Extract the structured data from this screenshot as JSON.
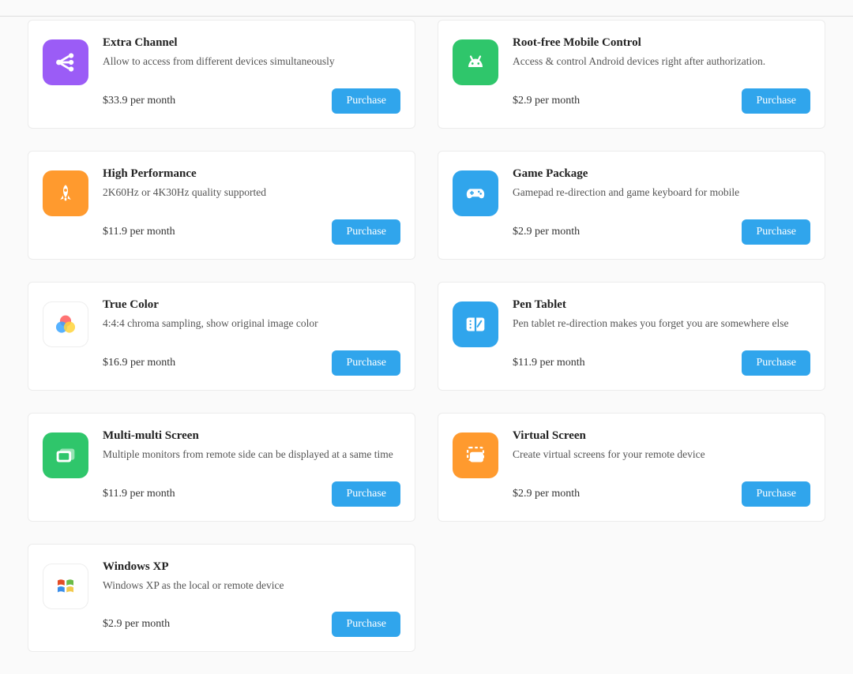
{
  "purchase_label": "Purchase",
  "products": [
    {
      "title": "Extra Channel",
      "desc": "Allow to access from different devices simultaneously",
      "price": "$33.9 per month",
      "icon": "share-icon",
      "bg": "#9b5cf6"
    },
    {
      "title": "Root-free Mobile Control",
      "desc": "Access & control Android devices right after authorization.",
      "price": "$2.9 per month",
      "icon": "android-icon",
      "bg": "#2fc66b"
    },
    {
      "title": "High Performance",
      "desc": "2K60Hz or 4K30Hz quality supported",
      "price": "$11.9 per month",
      "icon": "rocket-icon",
      "bg": "#ff9a2e"
    },
    {
      "title": "Game Package",
      "desc": "Gamepad re-direction and game keyboard for mobile",
      "price": "$2.9 per month",
      "icon": "gamepad-icon",
      "bg": "#30a5ec"
    },
    {
      "title": "True Color",
      "desc": "4:4:4 chroma sampling, show original image color",
      "price": "$16.9 per month",
      "icon": "color-icon",
      "bg": "white"
    },
    {
      "title": "Pen Tablet",
      "desc": "Pen tablet re-direction makes you forget you are somewhere else",
      "price": "$11.9 per month",
      "icon": "pen-tablet-icon",
      "bg": "#30a5ec"
    },
    {
      "title": "Multi-multi Screen",
      "desc": "Multiple monitors from remote side can be displayed at a same time",
      "price": "$11.9 per month",
      "icon": "monitor-icon",
      "bg": "#2fc66b"
    },
    {
      "title": "Virtual Screen",
      "desc": "Create virtual screens for your remote device",
      "price": "$2.9 per month",
      "icon": "virtual-screen-icon",
      "bg": "#ff9a2e"
    },
    {
      "title": "Windows XP",
      "desc": "Windows XP as the local or remote device",
      "price": "$2.9 per month",
      "icon": "windows-icon",
      "bg": "white"
    }
  ]
}
